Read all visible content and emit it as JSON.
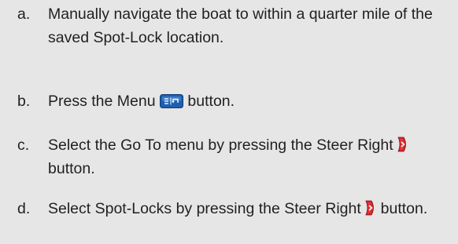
{
  "steps": [
    {
      "letter": "a.",
      "text": "Manually navigate the boat to within a quarter mile of the saved Spot-Lock location."
    },
    {
      "letter": "b.",
      "text_before": "Press the Menu",
      "icon": "menu-button-icon",
      "text_after": "button."
    },
    {
      "letter": "c.",
      "text_before": "Select the Go To menu by pressing the Steer Right",
      "icon": "steer-right-button-icon",
      "text_after": "button."
    },
    {
      "letter": "d.",
      "text_before": "Select Spot-Locks by pressing the Steer Right",
      "icon": "steer-right-button-icon",
      "text_after": "button."
    }
  ],
  "colors": {
    "background": "#e6e6e6",
    "text": "#231f20",
    "menu_button_blue": "#1f5fb0",
    "steer_button_red": "#d2232a"
  }
}
